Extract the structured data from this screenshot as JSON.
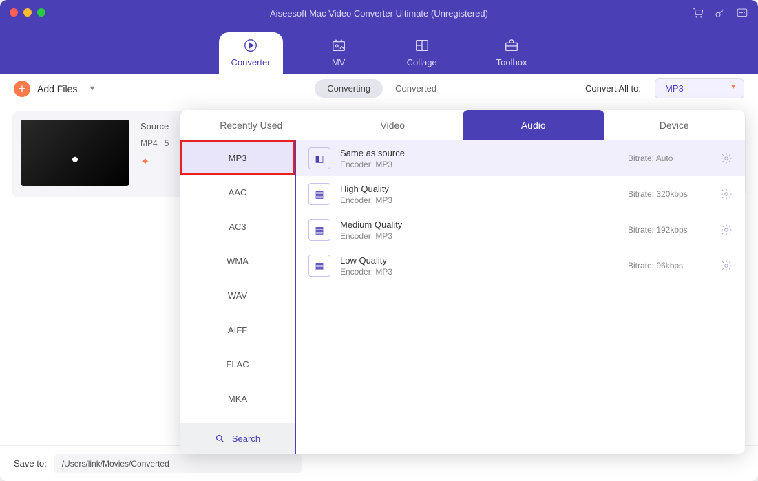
{
  "title": "Aiseesoft Mac Video Converter Ultimate (Unregistered)",
  "nav": {
    "converter": "Converter",
    "mv": "MV",
    "collage": "Collage",
    "toolbox": "Toolbox"
  },
  "toolbar": {
    "add_files": "Add Files",
    "converting": "Converting",
    "converted": "Converted",
    "convert_all_label": "Convert All to:",
    "convert_all_value": "MP3"
  },
  "file": {
    "source_label": "Source",
    "codec": "MP4",
    "extra": "5"
  },
  "footer": {
    "save_label": "Save to:",
    "save_path": "/Users/link/Movies/Converted"
  },
  "popup": {
    "tabs": {
      "recent": "Recently Used",
      "video": "Video",
      "audio": "Audio",
      "device": "Device"
    },
    "formats": [
      "MP3",
      "AAC",
      "AC3",
      "WMA",
      "WAV",
      "AIFF",
      "FLAC",
      "MKA"
    ],
    "search": "Search",
    "presets": [
      {
        "title": "Same as source",
        "encoder": "Encoder: MP3",
        "bitrate": "Bitrate: Auto"
      },
      {
        "title": "High Quality",
        "encoder": "Encoder: MP3",
        "bitrate": "Bitrate: 320kbps"
      },
      {
        "title": "Medium Quality",
        "encoder": "Encoder: MP3",
        "bitrate": "Bitrate: 192kbps"
      },
      {
        "title": "Low Quality",
        "encoder": "Encoder: MP3",
        "bitrate": "Bitrate: 96kbps"
      }
    ]
  }
}
